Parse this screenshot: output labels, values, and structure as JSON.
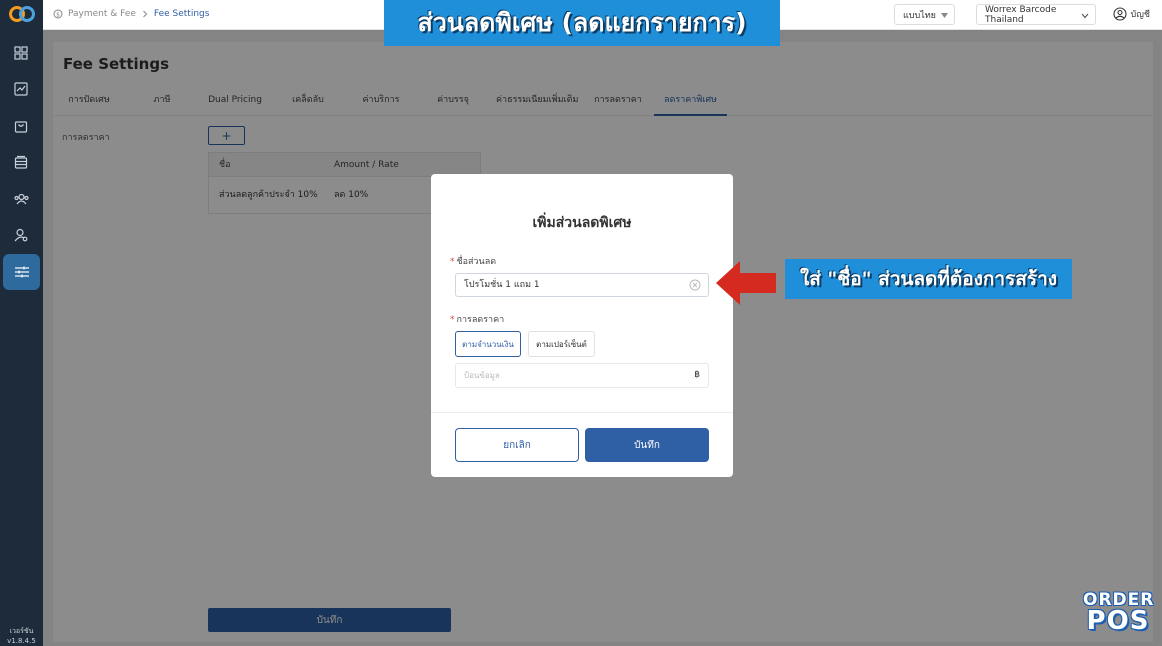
{
  "breadcrumb": {
    "parent": "Payment & Fee",
    "current": "Fee Settings"
  },
  "topbar": {
    "language": "แบบไทย",
    "store": "Worrex Barcode Thailand",
    "account_label": "บัญชี"
  },
  "page": {
    "title": "Fee Settings"
  },
  "tabs": [
    {
      "label": "การปัดเศษ",
      "active": false
    },
    {
      "label": "ภาษี",
      "active": false
    },
    {
      "label": "Dual Pricing",
      "active": false
    },
    {
      "label": "เคล็ดลับ",
      "active": false
    },
    {
      "label": "ค่าบริการ",
      "active": false
    },
    {
      "label": "ค่าบรรจุ",
      "active": false
    },
    {
      "label": "ค่าธรรมเนียมเพิ่มเติม",
      "active": false
    },
    {
      "label": "การลดราคา",
      "active": false
    },
    {
      "label": "ลดราคาพิเศษ",
      "active": true
    }
  ],
  "discount_section": {
    "label": "การลดราคา",
    "add_label": "+",
    "columns": [
      "ชื่อ",
      "Amount / Rate"
    ],
    "rows": [
      {
        "name": "ส่วนลดลูกค้าประจำ 10%",
        "amount": "ลด 10%"
      }
    ]
  },
  "main_save_label": "บันทึก",
  "sidebar": {
    "version_line1": "เวอร์ชัน",
    "version_line2": "v1.8.4.5"
  },
  "modal": {
    "title": "เพิ่มส่วนลดพิเศษ",
    "name_label": "ชื่อส่วนลด",
    "name_value": "โปรโมชั่น 1 แถม 1",
    "discount_label": "การลดราคา",
    "type_amount": "ตามจำนวนเงิน",
    "type_percent": "ตามเปอร์เซ็นต์",
    "amount_placeholder": "ป้อนข้อมูล",
    "currency": "฿",
    "cancel_label": "ยกเลิก",
    "save_label": "บันทึก"
  },
  "annotations": {
    "top_banner": "ส่วนลดพิเศษ (ลดแยกรายการ)",
    "side_note": "ใส่ \"ชื่อ\" ส่วนลดที่ต้องการสร้าง"
  },
  "watermark": {
    "line1": "ORDER",
    "line2": "POS"
  },
  "colors": {
    "primary": "#2f5fa5",
    "sidebar": "#1e2b3a",
    "banner": "#1f8fd9",
    "arrow": "#d42a1f"
  },
  "icons": [
    "logo-icon",
    "grid-icon",
    "chart-icon",
    "bag-icon",
    "box-icon",
    "users-icon",
    "user-settings-icon",
    "sliders-icon",
    "shield-icon",
    "chevron-right-icon",
    "chevron-down-icon",
    "account-icon",
    "clear-icon"
  ]
}
